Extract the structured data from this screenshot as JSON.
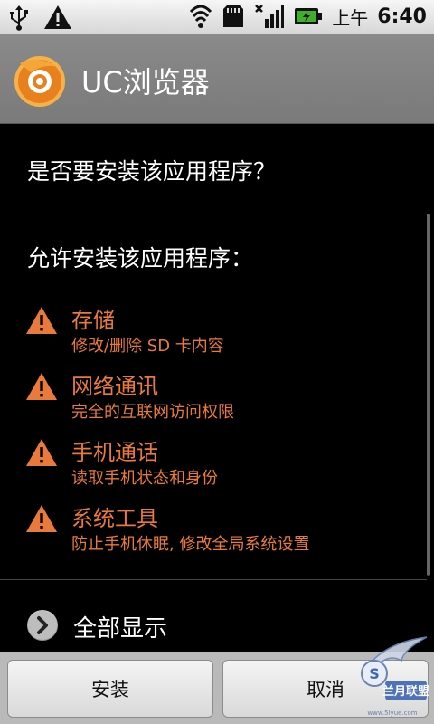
{
  "status_bar": {
    "icons_left": [
      "usb-icon",
      "warning-icon"
    ],
    "icons_right": [
      "wifi-icon",
      "sd-card-icon",
      "signal-icon",
      "battery-charging-icon"
    ],
    "ampm": "上午",
    "time": "6:40"
  },
  "title_bar": {
    "app_name": "UC浏览器",
    "icon": "uc-browser-logo-icon"
  },
  "content": {
    "question": "是否要安装该应用程序？",
    "permissions_header": "允许安装该应用程序：",
    "permissions": [
      {
        "name": "存储",
        "description": "修改/删除 SD 卡内容"
      },
      {
        "name": "网络通讯",
        "description": "完全的互联网访问权限"
      },
      {
        "name": "手机通话",
        "description": "读取手机状态和身份"
      },
      {
        "name": "系统工具",
        "description": "防止手机休眠, 修改全局系统设置"
      }
    ],
    "show_all": "全部显示"
  },
  "buttons": {
    "install": "安装",
    "cancel": "取消"
  },
  "watermark": {
    "text": "兰月联盟",
    "subtext": "www.5lyue.com"
  },
  "colors": {
    "permission_text": "#e97a3b",
    "warning_icon": "#e97a3b",
    "title_bar": "#828282"
  }
}
